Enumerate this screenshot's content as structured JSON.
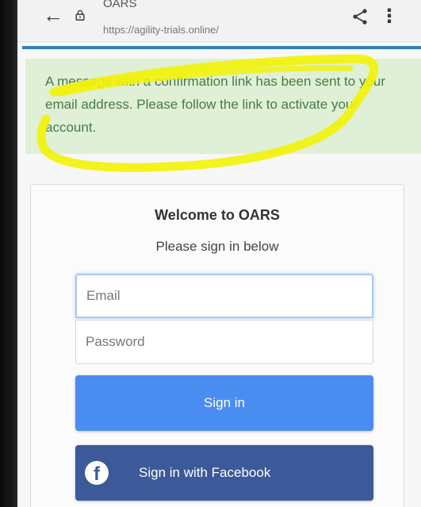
{
  "browser": {
    "page_title": "OARS",
    "url": "https://agility-trials.online/"
  },
  "alert": {
    "message": "A message with a confirmation link has been sent to your email address. Please follow the link to activate your account."
  },
  "login": {
    "title": "Welcome to OARS",
    "subtitle": "Please sign in below",
    "email_placeholder": "Email",
    "password_placeholder": "Password",
    "signin_label": "Sign in",
    "facebook_label": "Sign in with Facebook",
    "facebook_icon_glyph": "f"
  },
  "colors": {
    "accent_line": "#2f7fb7",
    "alert_background": "#dff0d6",
    "alert_text": "#4a7a45",
    "signin_button": "#4a8df0",
    "facebook_button": "#3c5a99",
    "highlighter": "#f2f20a"
  },
  "icons": [
    "back-arrow-icon",
    "lock-icon",
    "share-icon",
    "more-vert-icon",
    "facebook-icon"
  ]
}
